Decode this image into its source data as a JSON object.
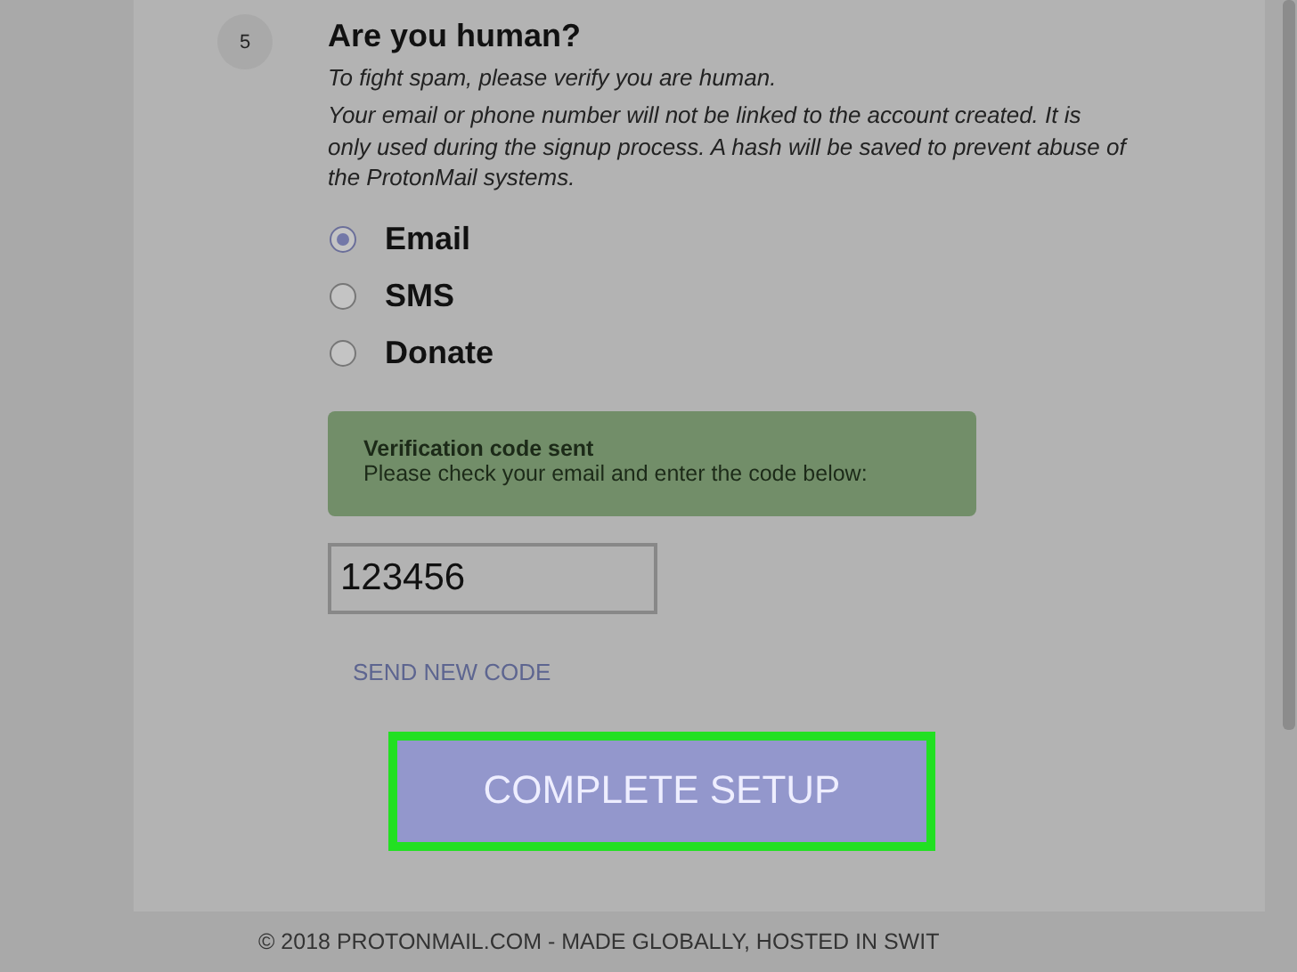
{
  "step": {
    "number": "5",
    "title": "Are you human?",
    "subtitle": "To fight spam, please verify you are human.",
    "notice": "Your email or phone number will not be linked to the account created. It is only used during the signup process. A hash will be saved to prevent abuse of the ProtonMail systems."
  },
  "methods": [
    {
      "label": "Email",
      "selected": true
    },
    {
      "label": "SMS",
      "selected": false
    },
    {
      "label": "Donate",
      "selected": false
    }
  ],
  "alert": {
    "title": "Verification code sent",
    "message": "Please check your email and enter the code below:"
  },
  "code_field": {
    "value": "123456"
  },
  "resend_link": "SEND NEW CODE",
  "submit_button": {
    "label": "COMPLETE SETUP",
    "highlighted": true
  },
  "footer": "© 2018 PROTONMAIL.COM - MADE GLOBALLY, HOSTED IN SWIT"
}
